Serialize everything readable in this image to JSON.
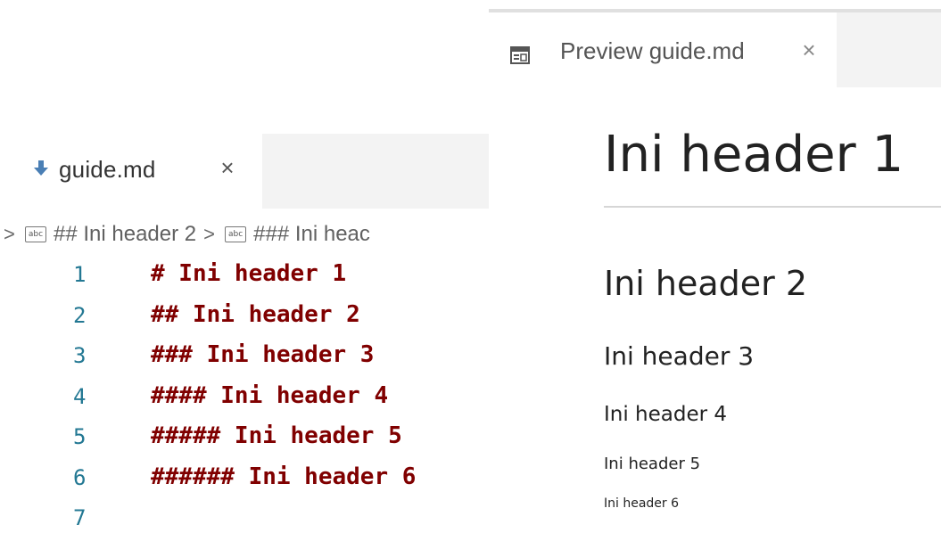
{
  "editor": {
    "tab": {
      "label": "guide.md",
      "close": "×",
      "icon": "markdown-download-icon"
    },
    "breadcrumb": {
      "chevron": ">",
      "items": [
        {
          "icon": "abc-string-icon",
          "icon_text": "abc",
          "label": "## Ini header 2"
        },
        {
          "icon": "abc-string-icon",
          "icon_text": "abc",
          "label": "### Ini heac"
        }
      ]
    },
    "lines": [
      {
        "num": "1",
        "text": "# Ini header 1"
      },
      {
        "num": "2",
        "text": "## Ini header 2"
      },
      {
        "num": "3",
        "text": "### Ini header 3"
      },
      {
        "num": "4",
        "text": "#### Ini header 4"
      },
      {
        "num": "5",
        "text": "##### Ini header 5"
      },
      {
        "num": "6",
        "text": "###### Ini header 6"
      },
      {
        "num": "7",
        "text": ""
      }
    ],
    "colors": {
      "line_number": "#237893",
      "markdown_text": "#800000"
    }
  },
  "preview": {
    "tab": {
      "label": "Preview guide.md",
      "close": "×",
      "icon": "preview-icon"
    },
    "headings": {
      "h1": "Ini header 1",
      "h2": "Ini header 2",
      "h3": "Ini header 3",
      "h4": "Ini header 4",
      "h5": "Ini header 5",
      "h6": "Ini header 6"
    }
  }
}
